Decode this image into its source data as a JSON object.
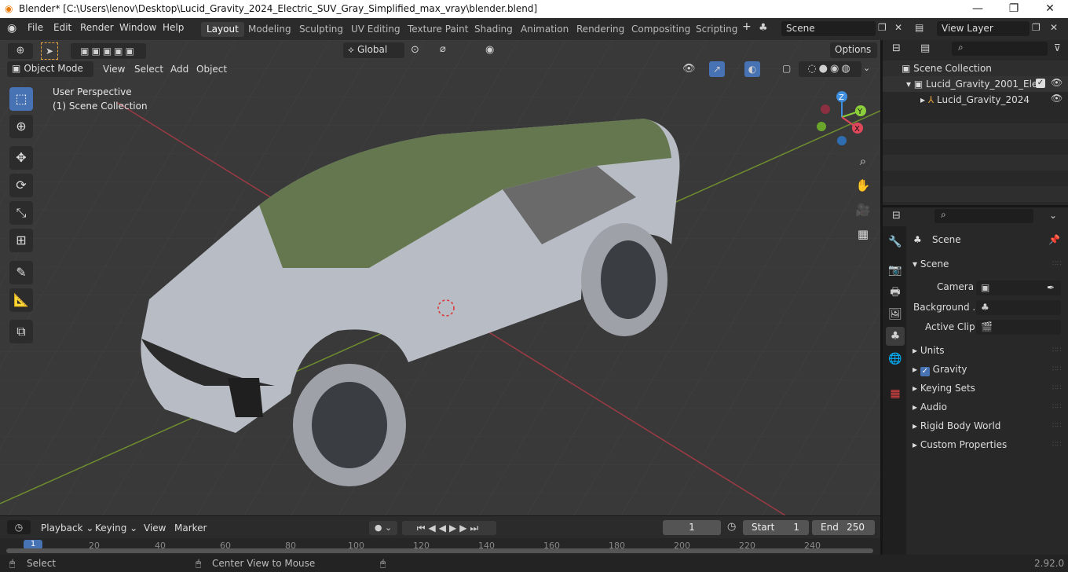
{
  "window": {
    "title": "Blender* [C:\\Users\\lenov\\Desktop\\Lucid_Gravity_2024_Electric_SUV_Gray_Simplified_max_vray\\blender.blend]",
    "minimize": "—",
    "maximize": "❐",
    "close": "✕"
  },
  "menu": [
    "File",
    "Edit",
    "Render",
    "Window",
    "Help"
  ],
  "workspaces": [
    "Layout",
    "Modeling",
    "Sculpting",
    "UV Editing",
    "Texture Paint",
    "Shading",
    "Animation",
    "Rendering",
    "Compositing",
    "Scripting"
  ],
  "add_ws": "+",
  "scene": {
    "label": "Scene",
    "view_layer": "View Layer"
  },
  "header": {
    "transform": "Global",
    "options": "Options",
    "mode": "Object Mode",
    "menus": [
      "View",
      "Select",
      "Add",
      "Object"
    ]
  },
  "viewport": {
    "perspective": "User Perspective",
    "collection": "(1) Scene Collection",
    "gizmo": {
      "z": "Z",
      "y": "Y",
      "x": "X"
    }
  },
  "outliner": {
    "root": "Scene Collection",
    "collection": "Lucid_Gravity_2001_Ele",
    "object": "Lucid_Gravity_2024"
  },
  "properties": {
    "title": "Scene",
    "section": "Scene",
    "camera": "Camera",
    "background": "Background ...",
    "clip": "Active Clip",
    "panels": [
      "Units",
      "Gravity",
      "Keying Sets",
      "Audio",
      "Rigid Body World",
      "Custom Properties"
    ],
    "gravity_checked": true
  },
  "timeline": {
    "menus": [
      "Playback",
      "Keying",
      "View",
      "Marker"
    ],
    "frame": "1",
    "start_label": "Start",
    "start": "1",
    "end_label": "End",
    "end": "250",
    "ticks": [
      "1",
      "20",
      "40",
      "60",
      "80",
      "100",
      "120",
      "140",
      "160",
      "180",
      "200",
      "220",
      "240"
    ]
  },
  "status": {
    "select": "Select",
    "center": "Center View to Mouse",
    "version": "2.92.0"
  },
  "colors": {
    "accent": "#4772b3",
    "x_axis": "#e1485c",
    "y_axis": "#8ccf3b",
    "z_axis": "#3f8fe0"
  }
}
